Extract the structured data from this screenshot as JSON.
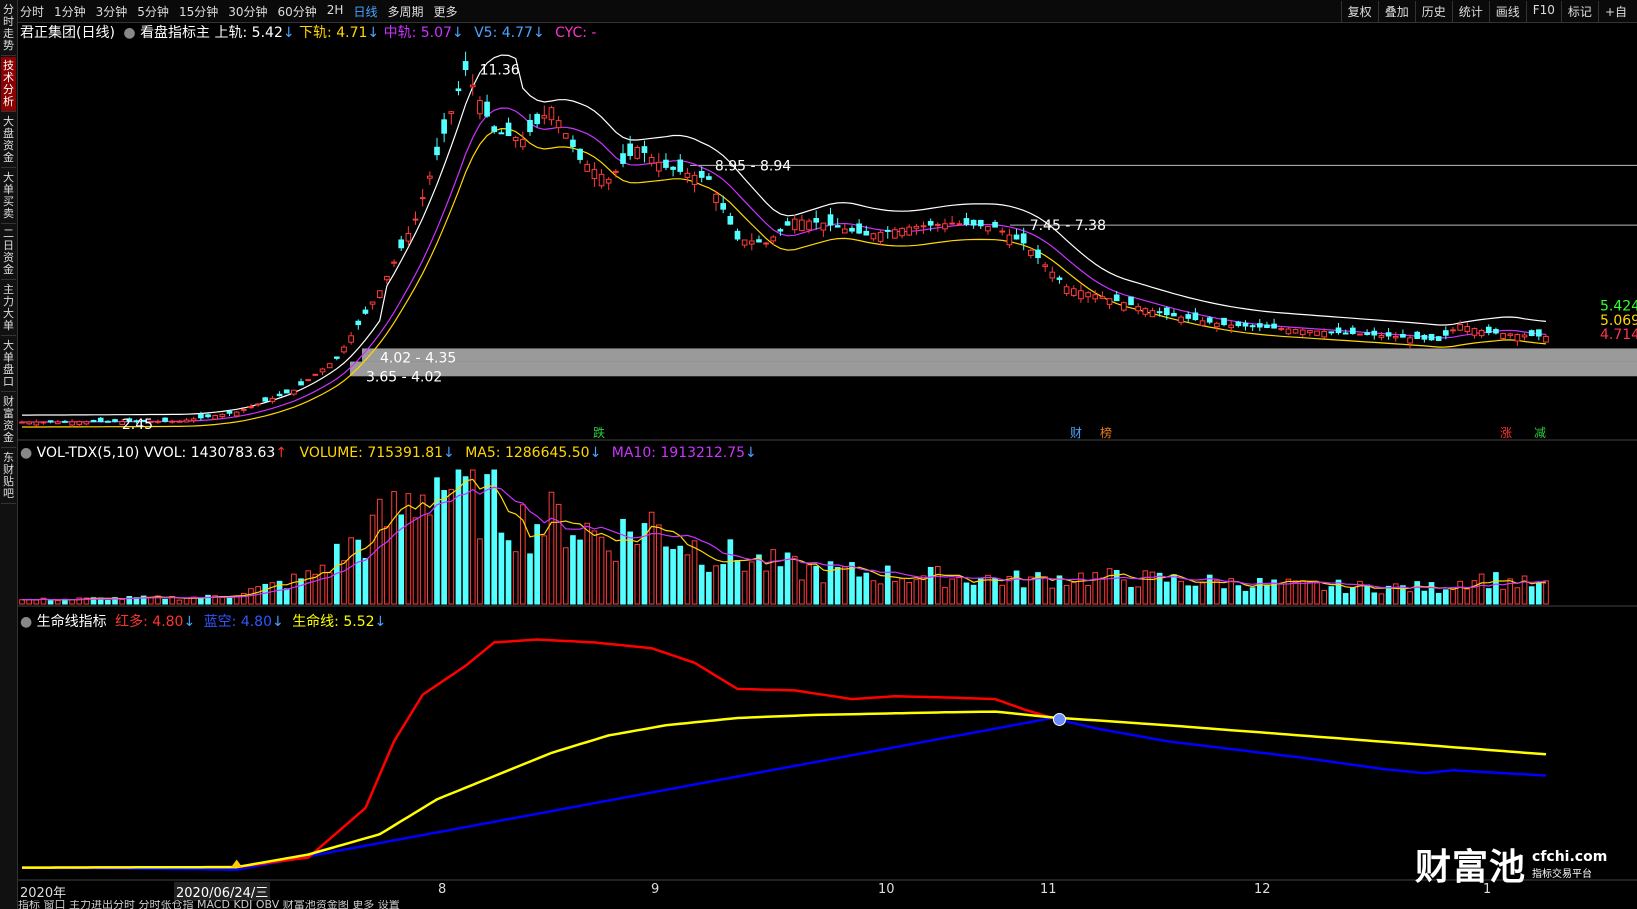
{
  "topbar": {
    "tabs": [
      "分时",
      "1分钟",
      "3分钟",
      "5分钟",
      "15分钟",
      "30分钟",
      "60分钟",
      "2H",
      "日线",
      "多周期",
      "更多"
    ],
    "active_tab": "日线",
    "right_tools": [
      "复权",
      "叠加",
      "历史",
      "统计",
      "画线",
      "F10",
      "标记",
      "+自"
    ]
  },
  "leftbar": {
    "tabs": [
      "分时走势",
      "技术分析",
      "大盘资金",
      "大单买卖",
      "二日资金",
      "主力大单",
      "大单盘口",
      "财富资金",
      "东财贴吧"
    ],
    "active": "技术分析"
  },
  "main_header": {
    "title": "君正集团(日线)",
    "indicator": "看盘指标主",
    "upper": "上轨: 5.42",
    "lower": "下轨: 4.71",
    "mid": "中轨: 5.07",
    "v5": "V5: 4.77",
    "cyc": "CYC: -"
  },
  "vol_header": {
    "name": "VOL-TDX(5,10)",
    "vvol": "VVOL: 1430783.63",
    "volume": "VOLUME: 715391.81",
    "ma5": "MA5: 1286645.50",
    "ma10": "MA10: 1913212.75"
  },
  "life_header": {
    "name": "生命线指标",
    "red": "红多: 4.80",
    "blue": "蓝空: 4.80",
    "life": "生命线: 5.52"
  },
  "annotations": {
    "high": "11.36",
    "low": "2.45",
    "zone1": "8.95 - 8.94",
    "zone2": "7.45 - 7.38",
    "zone3": "4.02 - 4.35",
    "zone4": "3.65 - 4.02",
    "right_upper": "5.424",
    "right_mid": "5.069",
    "right_lower": "4.714"
  },
  "event_tags": [
    {
      "label": "跌",
      "color": "#2ecc40"
    },
    {
      "label": "财",
      "color": "#4aa3ff"
    },
    {
      "label": "榜",
      "color": "#e67e22"
    },
    {
      "label": "涨",
      "color": "#ff3333"
    },
    {
      "label": "减",
      "color": "#2ecc40"
    }
  ],
  "xaxis": {
    "labels": [
      "2020年",
      "8",
      "9",
      "10",
      "11",
      "12",
      "1"
    ],
    "cursor_date": "2020/06/24/三"
  },
  "bottom_bar": "指标  窗口  主力进出分时  分时张仓指  MACD  KDJ  OBV  财富池资金图  更多  设置",
  "logo": {
    "main": "财富池",
    "site": "cfchi.com",
    "sub": "指标交易平台"
  },
  "colors": {
    "up": "#ff3b3b",
    "down": "#54ffff",
    "upper": "#ffffff",
    "lower": "#ffd700",
    "mid": "#cc33ff",
    "red_line": "#ff0000",
    "yellow_line": "#ffff00",
    "blue_line": "#0000ff"
  },
  "chart_data": {
    "type": "candlestick",
    "ylim": [
      2.3,
      11.8
    ],
    "price_key_points": [
      [
        0,
        2.5
      ],
      [
        22,
        2.52
      ],
      [
        30,
        2.75
      ],
      [
        38,
        3.3
      ],
      [
        44,
        4.1
      ],
      [
        50,
        5.8
      ],
      [
        55,
        7.6
      ],
      [
        60,
        10.3
      ],
      [
        62,
        11.36
      ],
      [
        66,
        9.8
      ],
      [
        70,
        9.6
      ],
      [
        74,
        10.4
      ],
      [
        78,
        9.1
      ],
      [
        82,
        8.6
      ],
      [
        86,
        9.4
      ],
      [
        90,
        8.9
      ],
      [
        96,
        8.6
      ],
      [
        100,
        7.1
      ],
      [
        104,
        7.0
      ],
      [
        108,
        7.6
      ],
      [
        112,
        7.5
      ],
      [
        118,
        7.2
      ],
      [
        124,
        7.4
      ],
      [
        130,
        7.5
      ],
      [
        136,
        7.4
      ],
      [
        140,
        7.0
      ],
      [
        146,
        5.9
      ],
      [
        152,
        5.6
      ],
      [
        160,
        5.2
      ],
      [
        168,
        4.95
      ],
      [
        176,
        4.85
      ],
      [
        184,
        4.75
      ],
      [
        192,
        4.65
      ],
      [
        198,
        4.55
      ],
      [
        201,
        4.95
      ],
      [
        205,
        4.75
      ],
      [
        213,
        4.65
      ]
    ],
    "volume_key_points": [
      [
        0,
        0.03
      ],
      [
        26,
        0.05
      ],
      [
        34,
        0.12
      ],
      [
        40,
        0.2
      ],
      [
        48,
        0.5
      ],
      [
        54,
        0.75
      ],
      [
        58,
        0.95
      ],
      [
        62,
        0.8
      ],
      [
        66,
        0.75
      ],
      [
        70,
        0.6
      ],
      [
        76,
        0.62
      ],
      [
        82,
        0.48
      ],
      [
        88,
        0.6
      ],
      [
        92,
        0.48
      ],
      [
        96,
        0.38
      ],
      [
        104,
        0.3
      ],
      [
        110,
        0.25
      ],
      [
        120,
        0.22
      ],
      [
        130,
        0.2
      ],
      [
        140,
        0.18
      ],
      [
        148,
        0.2
      ],
      [
        160,
        0.18
      ],
      [
        180,
        0.13
      ],
      [
        198,
        0.12
      ],
      [
        203,
        0.2
      ],
      [
        213,
        0.13
      ]
    ],
    "red_line": [
      [
        0,
        2.45
      ],
      [
        30,
        2.47
      ],
      [
        40,
        2.8
      ],
      [
        48,
        4.5
      ],
      [
        52,
        6.8
      ],
      [
        56,
        8.4
      ],
      [
        62,
        9.4
      ],
      [
        66,
        10.2
      ],
      [
        72,
        10.3
      ],
      [
        80,
        10.2
      ],
      [
        88,
        10.0
      ],
      [
        94,
        9.5
      ],
      [
        100,
        8.6
      ],
      [
        108,
        8.55
      ],
      [
        116,
        8.25
      ],
      [
        122,
        8.35
      ],
      [
        130,
        8.3
      ],
      [
        136,
        8.25
      ],
      [
        140,
        7.9
      ],
      [
        144,
        7.6
      ]
    ],
    "blue_line": [
      [
        0,
        2.45
      ],
      [
        30,
        2.38
      ],
      [
        144,
        7.6
      ],
      [
        150,
        7.25
      ],
      [
        160,
        6.8
      ],
      [
        170,
        6.5
      ],
      [
        180,
        6.2
      ],
      [
        190,
        5.85
      ],
      [
        196,
        5.7
      ],
      [
        200,
        5.8
      ],
      [
        213,
        5.62
      ]
    ],
    "yellow_line": [
      [
        0,
        2.45
      ],
      [
        30,
        2.47
      ],
      [
        40,
        2.9
      ],
      [
        50,
        3.6
      ],
      [
        58,
        4.8
      ],
      [
        66,
        5.6
      ],
      [
        74,
        6.4
      ],
      [
        82,
        7.0
      ],
      [
        90,
        7.35
      ],
      [
        100,
        7.6
      ],
      [
        110,
        7.7
      ],
      [
        120,
        7.75
      ],
      [
        130,
        7.8
      ],
      [
        136,
        7.82
      ],
      [
        144,
        7.62
      ],
      [
        160,
        7.35
      ],
      [
        176,
        7.05
      ],
      [
        192,
        6.75
      ],
      [
        205,
        6.5
      ],
      [
        213,
        6.35
      ]
    ],
    "life_ylim": [
      2.3,
      10.8
    ]
  }
}
